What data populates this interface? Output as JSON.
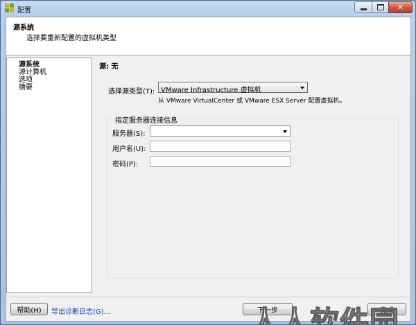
{
  "window": {
    "title": "配置",
    "controls": {
      "minimize_icon": "minimize-icon",
      "maximize_icon": "maximize-icon",
      "close_icon": "close-icon"
    }
  },
  "header": {
    "title": "源系统",
    "subtitle": "选择要重新配置的虚拟机类型"
  },
  "sidebar": {
    "items": [
      {
        "label": "源系统",
        "active": true
      },
      {
        "label": "源计算机",
        "active": false
      },
      {
        "label": "选项",
        "active": false
      },
      {
        "label": "摘要",
        "active": false
      }
    ]
  },
  "main": {
    "source_label": "源: 无",
    "source_type_label": "选择源类型(T):",
    "source_type_value": "VMware Infrastructure 虚拟机",
    "source_type_hint": "从 VMware VirtualCenter 或 VMware ESX Server 配置虚拟机。",
    "connection_group": {
      "title": "指定服务器连接信息",
      "server_label": "服务器(S):",
      "server_value": "",
      "username_label": "用户名(U):",
      "username_value": "",
      "password_label": "密码(P):",
      "password_value": ""
    }
  },
  "footer": {
    "help_button": "帮助(H)",
    "export_log_link": "导出诊断日志(G)...",
    "next_button": "下一步",
    "finish_button": "完成"
  },
  "watermark": "人人软件园",
  "colors": {
    "title_gradient_top": "#c5dbf2",
    "close_button": "#c75a45",
    "link": "#0645ad",
    "client_bg": "#f0f0f0"
  }
}
